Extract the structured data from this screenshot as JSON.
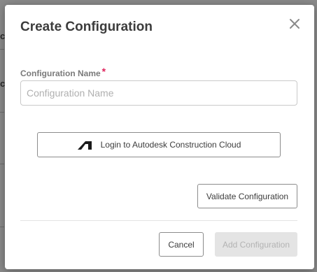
{
  "dialog": {
    "title": "Create Configuration",
    "close_icon": "close-icon"
  },
  "form": {
    "name_label": "Configuration Name",
    "required_marker": "*",
    "name_value": "",
    "name_placeholder": "Configuration Name"
  },
  "actions": {
    "login_label": "Login to Autodesk Construction Cloud",
    "login_icon": "autodesk-logo-icon",
    "validate_label": "Validate Configuration",
    "cancel_label": "Cancel",
    "add_label": "Add Configuration",
    "add_enabled": false
  },
  "colors": {
    "required": "#e0245e",
    "overlay": "#8a8a8a",
    "disabled_bg": "#e4e4e4",
    "disabled_text": "#b3b3b3"
  }
}
